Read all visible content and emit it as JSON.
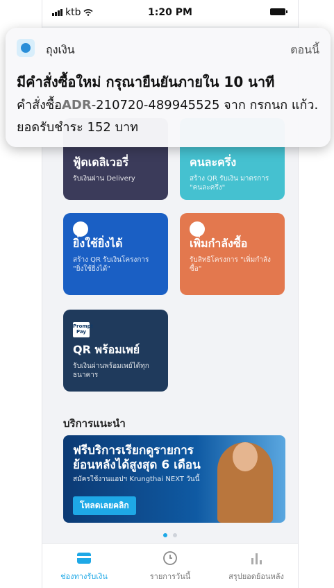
{
  "status_bar": {
    "carrier": "ktb",
    "time": "1:20 PM"
  },
  "notification": {
    "app_name": "ถุงเงิน",
    "time": "ตอนนี้",
    "title": "มีคำสั่งซื้อใหม่ กรุณายืนยันภายใน 10 นาที",
    "body_prefix": "คำสั่งซื้อ",
    "order_code_prefix": "ADR",
    "body_rest": "-210720-489945525 จาก กรกนก แก้ว. ยอดรับชำระ 152 บาท"
  },
  "cards": [
    {
      "title": "ฟู้ดเดลิเวอรี่",
      "subtitle": "รับเงินผ่าน Delivery",
      "color": "#3b3b5a"
    },
    {
      "title": "คนละครึ่ง",
      "subtitle": "สร้าง QR รับเงิน มาตรการ \"คนละครึ่ง\"",
      "color": "#45c1d0"
    },
    {
      "title": "ยิ่งใช้ยิ่งได้",
      "subtitle": "สร้าง QR รับเงินโครงการ \"ยิ่งใช้ยิ่งได้\"",
      "color": "#1a5fc4"
    },
    {
      "title": "เพิ่มกำลังซื้อ",
      "subtitle": "รับสิทธิโครงการ \"เพิ่มกำลังซื้อ\"",
      "color": "#e3784e"
    },
    {
      "title": "QR พร้อมเพย์",
      "subtitle": "รับเงินผ่านพร้อมเพย์ได้ทุก ธนาคาร",
      "color": "#1f3a5c",
      "badge": "Prompt Pay"
    }
  ],
  "section": {
    "title": "บริการแนะนำ"
  },
  "banner": {
    "headline": "ฟรีบริการเรียกดูรายการ ย้อนหลังได้สูงสุด 6 เดือน",
    "subtext": "สมัครใช้งานแอปฯ Krungthai NEXT วันนี้",
    "button": "โหลดเลยคลิก"
  },
  "pager": {
    "count": 2,
    "active": 0
  },
  "tabbar": [
    {
      "label": "ช่องทางรับเงิน",
      "icon": "wallet-icon",
      "active": true
    },
    {
      "label": "รายการวันนี้",
      "icon": "clock-icon",
      "active": false
    },
    {
      "label": "สรุปยอดย้อนหลัง",
      "icon": "bar-chart-icon",
      "active": false
    }
  ],
  "colors": {
    "accent": "#1ea8e6"
  }
}
